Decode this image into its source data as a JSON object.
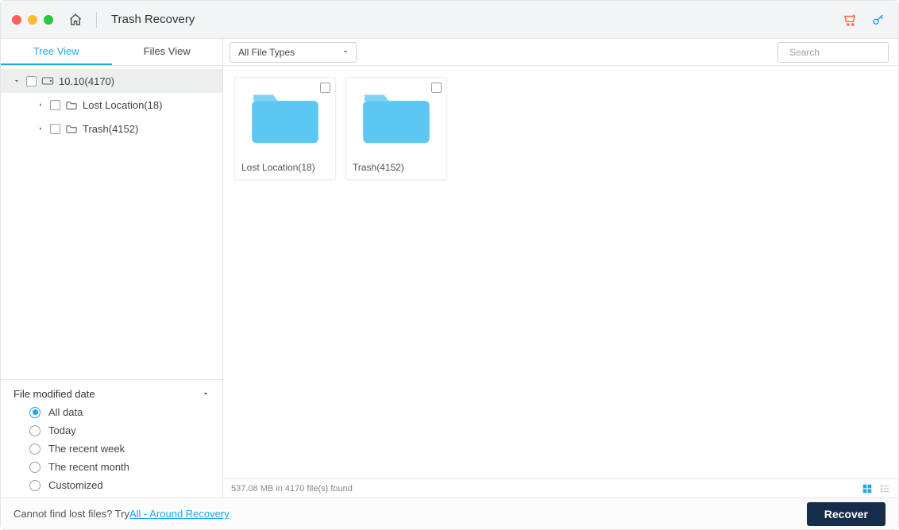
{
  "titlebar": {
    "app_title": "Trash Recovery"
  },
  "tabs": {
    "tree_view": "Tree View",
    "files_view": "Files View",
    "active": "tree_view"
  },
  "filter_select": {
    "label": "All File Types"
  },
  "search": {
    "placeholder": "Search"
  },
  "tree": {
    "root": {
      "label": "10.10(4170)"
    },
    "children": [
      {
        "label": "Lost Location(18)"
      },
      {
        "label": "Trash(4152)"
      }
    ]
  },
  "date_filter": {
    "title": "File modified date",
    "options": [
      {
        "label": "All data",
        "checked": true
      },
      {
        "label": "Today",
        "checked": false
      },
      {
        "label": "The recent week",
        "checked": false
      },
      {
        "label": "The recent month",
        "checked": false
      },
      {
        "label": "Customized",
        "checked": false
      }
    ]
  },
  "grid": {
    "items": [
      {
        "label": "Lost Location(18)"
      },
      {
        "label": "Trash(4152)"
      }
    ]
  },
  "status": {
    "text": "537.08 MB in 4170 file(s) found"
  },
  "footer": {
    "prompt": "Cannot find lost files? Try ",
    "link": "All - Around Recovery",
    "recover": "Recover"
  },
  "colors": {
    "accent": "#1ca8e8",
    "folder": "#5cc7f2",
    "recover_bg": "#142d4a",
    "cart": "#ff6b4a"
  }
}
